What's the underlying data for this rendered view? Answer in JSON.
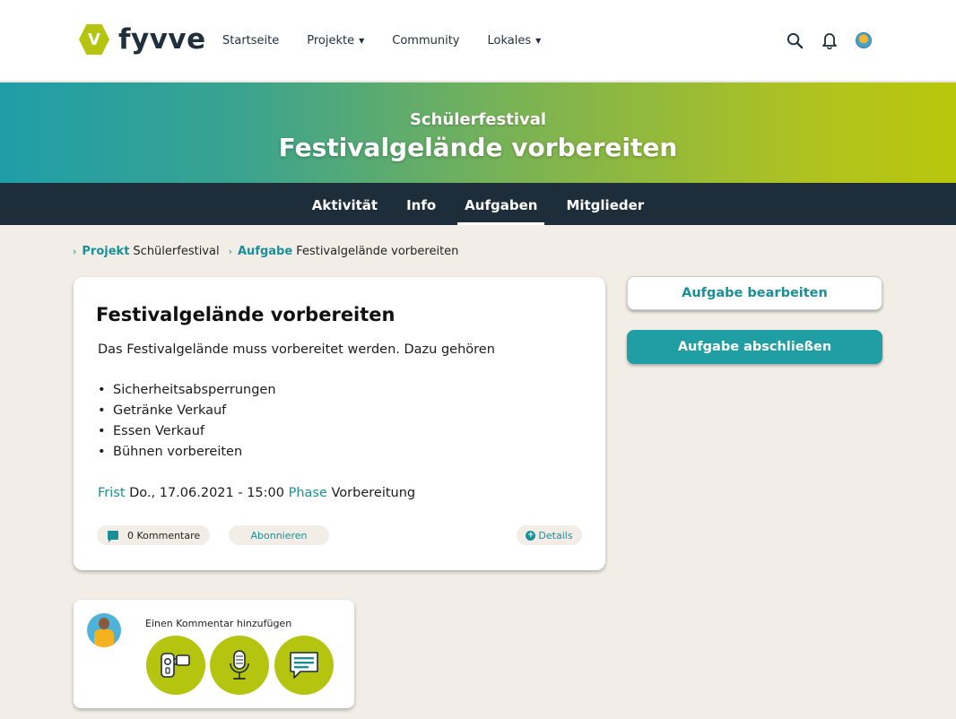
{
  "header": {
    "logo_letter": "V",
    "logo_text": "fyvve",
    "nav": [
      {
        "label": "Startseite",
        "dropdown": false
      },
      {
        "label": "Projekte",
        "dropdown": true
      },
      {
        "label": "Community",
        "dropdown": false
      },
      {
        "label": "Lokales",
        "dropdown": true
      }
    ],
    "icons": [
      "search-icon",
      "bell-icon",
      "user-avatar"
    ]
  },
  "banner": {
    "subtitle": "Schülerfestival",
    "title": "Festivalgelände vorbereiten"
  },
  "tabs": [
    {
      "label": "Aktivität",
      "active": false
    },
    {
      "label": "Info",
      "active": false
    },
    {
      "label": "Aufgaben",
      "active": true
    },
    {
      "label": "Mitglieder",
      "active": false
    }
  ],
  "breadcrumb": [
    {
      "key": "Projekt",
      "value": "Schülerfestival"
    },
    {
      "key": "Aufgabe",
      "value": "Festivalgelände vorbereiten"
    }
  ],
  "task": {
    "title": "Festivalgelände vorbereiten",
    "description": "Das Festivalgelände muss vorbereitet werden. Dazu gehören",
    "items": [
      "Sicherheitsabsperrungen",
      "Getränke Verkauf",
      "Essen Verkauf",
      "Bühnen vorbereiten"
    ],
    "deadline_label": "Frist",
    "deadline_value": "Do., 17.06.2021 - 15:00",
    "phase_label": "Phase",
    "phase_value": "Vorbereitung",
    "comments_label": "0 Kommentare",
    "subscribe_label": "Abonnieren",
    "details_label": "Details"
  },
  "actions": {
    "edit_label": "Aufgabe bearbeiten",
    "complete_label": "Aufgabe abschließen"
  },
  "comment": {
    "label": "Einen Kommentar hinzufügen",
    "buttons": [
      "video-icon",
      "microphone-icon",
      "text-message-icon"
    ]
  },
  "colors": {
    "accent": "#1b8f98",
    "lime": "#b5c40f",
    "dark_nav": "#1d2d39",
    "background": "#f2eee7"
  }
}
